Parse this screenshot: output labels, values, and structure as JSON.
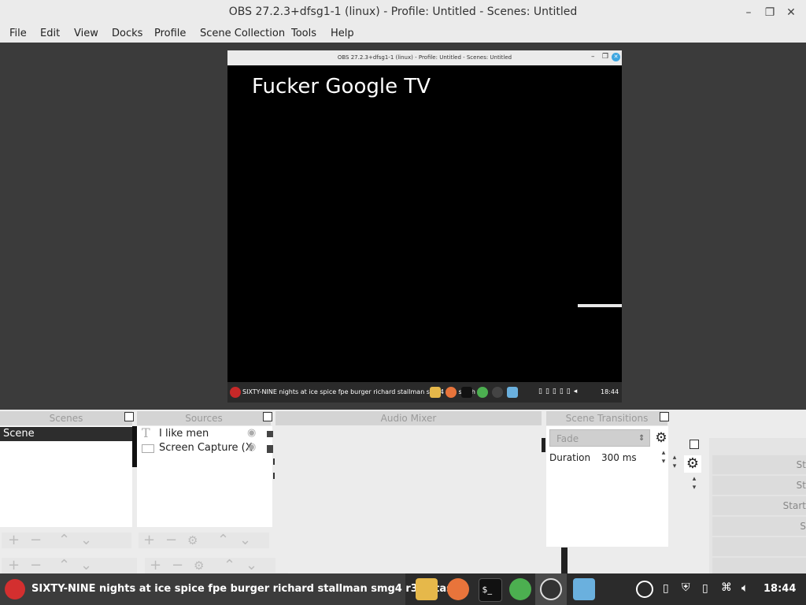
{
  "window": {
    "title": "OBS 27.2.3+dfsg1-1 (linux) - Profile: Untitled - Scenes: Untitled",
    "controls": {
      "minimize": "–",
      "maximize": "❐",
      "close": "✕"
    }
  },
  "menu": [
    "File",
    "Edit",
    "View",
    "Docks",
    "Profile",
    "Scene Collection",
    "Tools",
    "Help"
  ],
  "preview": {
    "nested_title": "OBS 27.2.3+dfsg1-1 (linux) - Profile: Untitled - Scenes: Untitled",
    "big_text": "Fucker Google TV",
    "nested_taskbar_text": "SIXTY-NINE nights at ice spice fpe burger richard stallman smg4 r34 stash",
    "nested_clock": "18:44"
  },
  "docks": {
    "scenes": {
      "header": "Scenes",
      "items": [
        "Scene"
      ]
    },
    "sources": {
      "header": "Sources",
      "items": [
        "I like men",
        "Screen Capture (X"
      ]
    },
    "mixer": {
      "header": "Audio Mixer"
    },
    "transitions": {
      "header": "Scene Transitions",
      "selected": "Fade",
      "duration_label": "Duration",
      "duration_value": "300 ms"
    },
    "controls": {
      "buttons": [
        "St",
        "St",
        "Start",
        "S",
        "",
        ""
      ]
    }
  },
  "taskbar": {
    "active_window": "SIXTY-NINE nights at ice spice fpe burger richard stallman smg4 r34 stash",
    "clock": "18:44"
  }
}
